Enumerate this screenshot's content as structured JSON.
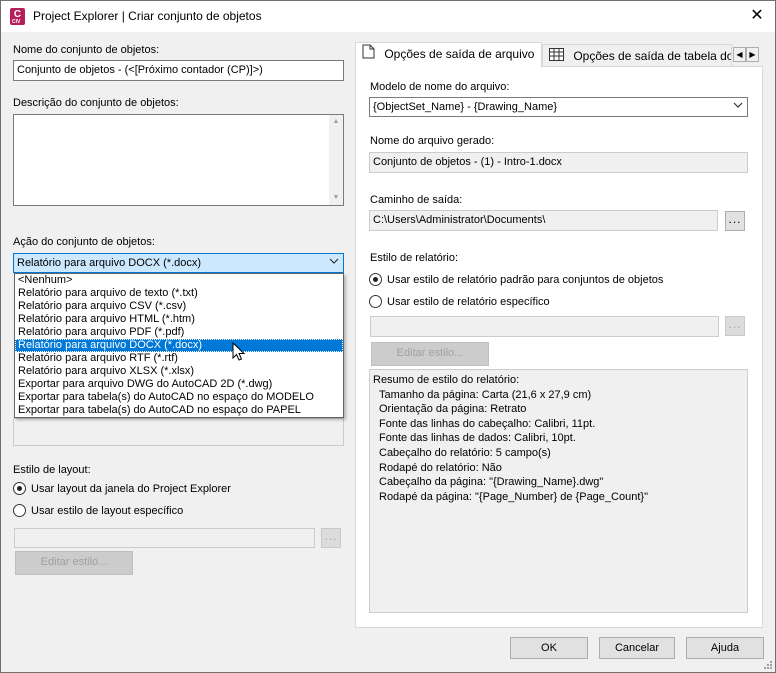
{
  "window": {
    "title": "Project Explorer | Criar conjunto de objetos",
    "app_icon_letter": "C",
    "app_icon_sub": "CIV"
  },
  "left": {
    "name_label": "Nome do conjunto de objetos:",
    "name_value": "Conjunto de objetos - (<[Próximo contador (CP)]>)",
    "description_label": "Descrição do conjunto de objetos:",
    "description_value": "",
    "action_label": "Ação do conjunto de objetos:",
    "action_selected": "Relatório para arquivo DOCX (*.docx)",
    "action_options": [
      "<Nenhum>",
      "Relatório para arquivo de texto (*.txt)",
      "Relatório para arquivo CSV (*.csv)",
      "Relatório para arquivo HTML (*.htm)",
      "Relatório para arquivo PDF (*.pdf)",
      "Relatório para arquivo DOCX (*.docx)",
      "Relatório para arquivo RTF (*.rtf)",
      "Relatório para arquivo XLSX (*.xlsx)",
      "Exportar para arquivo DWG do AutoCAD 2D (*.dwg)",
      "Exportar para tabela(s) do AutoCAD no espaço do MODELO",
      "Exportar para tabela(s) do AutoCAD no espaço do PAPEL"
    ],
    "action_selected_index": 5,
    "layout_style_label": "Estilo de layout:",
    "layout_radio_window": "Usar layout da janela do Project Explorer",
    "layout_radio_specific": "Usar estilo de layout específico",
    "layout_style_value": "",
    "layout_edit_button": "Editar estilo..."
  },
  "tabs": {
    "file_output": "Opções de saída de arquivo",
    "table_output": "Opções de saída de tabela do"
  },
  "right": {
    "filename_template_label": "Modelo de nome do arquivo:",
    "filename_template_value": "{ObjectSet_Name} - {Drawing_Name}",
    "generated_name_label": "Nome do arquivo gerado:",
    "generated_name_value": "Conjunto de objetos - (1) - Intro-1.docx",
    "output_path_label": "Caminho de saída:",
    "output_path_value": "C:\\Users\\Administrator\\Documents\\",
    "report_style_label": "Estilo de relatório:",
    "radio_default": "Usar estilo de relatório padrão para conjuntos de objetos",
    "radio_specific": "Usar estilo de relatório específico",
    "specific_style_value": "",
    "edit_style_button": "Editar estilo...",
    "summary_title": "Resumo de estilo do relatório:",
    "summary_lines": [
      "Tamanho da página: Carta (21,6 x 27,9 cm)",
      "Orientação da página: Retrato",
      "Fonte das linhas do cabeçalho: Calibri, 11pt.",
      "Fonte das linhas de dados: Calibri, 10pt.",
      "Cabeçalho do relatório: 5 campo(s)",
      "Rodapé do relatório: Não",
      "Cabeçalho da página: \"{Drawing_Name}.dwg\"",
      "Rodapé da página: \"{Page_Number} de {Page_Count}\""
    ]
  },
  "buttons": {
    "ok": "OK",
    "cancel": "Cancelar",
    "help": "Ajuda",
    "browse": "..."
  },
  "colors": {
    "selection": "#0078d7",
    "focus_fill": "#cce8ff",
    "app_icon": "#b5205a"
  }
}
